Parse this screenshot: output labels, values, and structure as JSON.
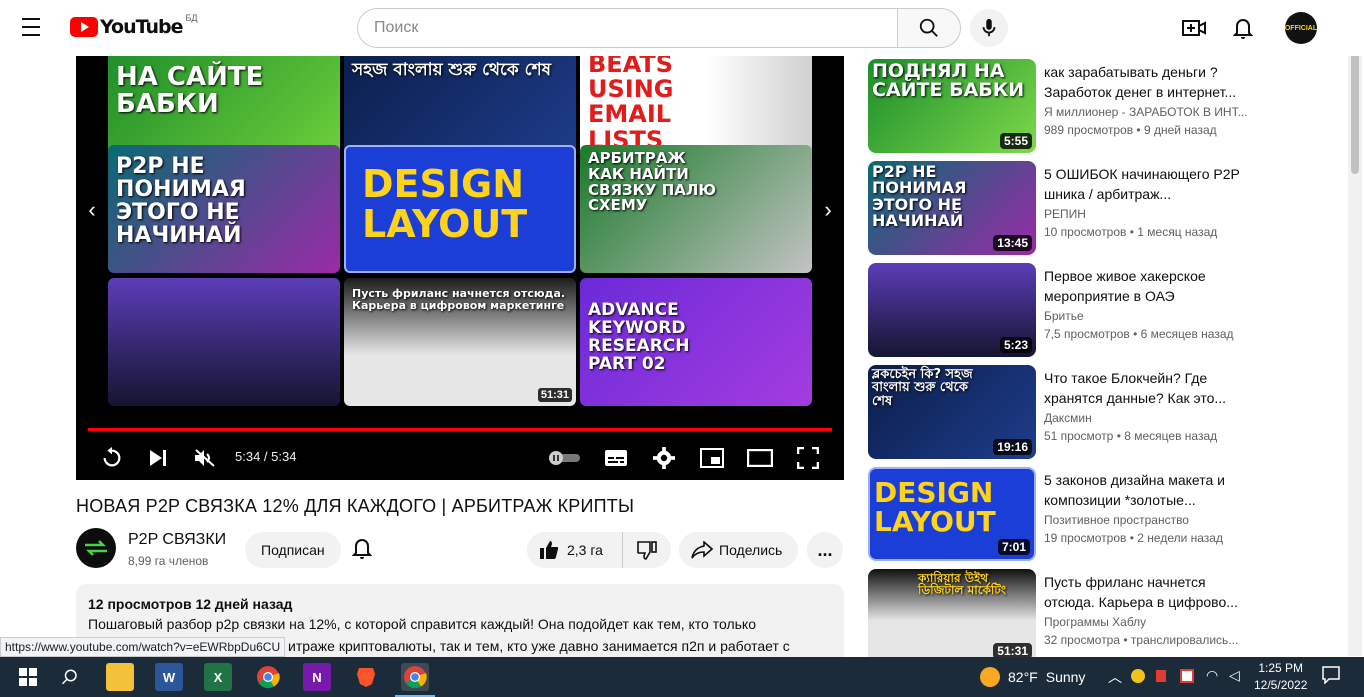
{
  "header": {
    "logo_text": "YouTube",
    "country_code": "БД",
    "search_placeholder": "Поиск",
    "avatar_text": "OFFICIAL"
  },
  "player": {
    "time_current": "5:34",
    "time_total": "5:34",
    "time_display": "5:34 / 5:34",
    "progress": 1.0,
    "endscreen": [
      {
        "text": "НА САЙТЕ БАБКИ",
        "duration": ""
      },
      {
        "text": "সহজ বাংলায় শুরু থেকে শেষ",
        "duration": ""
      },
      {
        "text": "BEATS USING EMAIL LISTS",
        "duration": ""
      },
      {
        "text": "P2P НЕ ПОНИМАЯ ЭТОГО НЕ НАЧИНАЙ",
        "duration": ""
      },
      {
        "text": "DESIGN LAYOUT",
        "duration": ""
      },
      {
        "text": "АРБИТРАЖ КАК НАЙТИ СВЯЗКУ ПАЛЮ СХЕМУ",
        "duration": ""
      },
      {
        "text": "",
        "duration": ""
      },
      {
        "text": "Пусть фриланс начнется отсюда. Карьера в цифровом маркетинге",
        "duration": "51:31"
      },
      {
        "text": "ADVANCE KEYWORD RESEARCH PART 02",
        "duration": ""
      }
    ]
  },
  "video": {
    "title": "НОВАЯ P2P СВЯЗКА 12% ДЛЯ КАЖДОГО | АРБИТРАЖ КРИПТЫ",
    "channel_name": "P2P СВЯЗКИ",
    "channel_subs": "8,99 га членов",
    "subscribe_label": "Подписан",
    "like_count": "2,3 га",
    "share_label": "Поделись",
    "more_label": "...",
    "desc_meta": "12 просмотров 12 дней назад",
    "desc_line1": "Пошаговый разбор p2p связки на 12%, с которой справится каждый! Она подойдет как тем, кто только",
    "desc_line2": "итраже криптовалюты, так и тем, кто уже давно занимается п2п и работает с"
  },
  "status_url": "https://www.youtube.com/watch?v=eEWRbpDu6CU",
  "recommendations": [
    {
      "title": "как зарабатывать деньги ? Заработок денег в интернет...",
      "channel": "Я миллионер - ЗАРАБОТОК В ИНТ...",
      "meta": "989 просмотров • 9 дней назад",
      "duration": "5:55",
      "thumb_text": "ПОДНЯЛ НА САЙТЕ БАБКИ"
    },
    {
      "title": "5 ОШИБОК начинающего P2P шника / арбитраж...",
      "channel": "РЕПИН",
      "meta": "10 просмотров • 1 месяц назад",
      "duration": "13:45",
      "thumb_text": "P2P НЕ ПОНИМАЯ ЭТОГО НЕ НАЧИНАЙ"
    },
    {
      "title": "Первое живое хакерское мероприятие в ОАЭ",
      "channel": "Бритье",
      "meta": "7,5 просмотров • 6 месяцев назад",
      "duration": "5:23",
      "thumb_text": ""
    },
    {
      "title": "Что такое Блокчейн? Где хранятся данные? Как это...",
      "channel": "Даксмин",
      "meta": "51 просмотр • 8 месяцев назад",
      "duration": "19:16",
      "thumb_text": "ব্লকচেইন কি? সহজ বাংলায় শুরু থেকে শেষ"
    },
    {
      "title": "5 законов дизайна макета и композиции *золотые...",
      "channel": "Позитивное пространство",
      "meta": "19 просмотров • 2 недели назад",
      "duration": "7:01",
      "thumb_text": "DESIGN LAYOUT"
    },
    {
      "title": "Пусть фриланс начнется отсюда. Карьера в цифрово...",
      "channel": "Программы Хаблу",
      "meta": "32 просмотра • транслировались...",
      "duration": "51:31",
      "thumb_text": "ক্যারিয়ার উইথ ডিজিটাল মার্কেটিং"
    }
  ],
  "taskbar": {
    "weather_temp": "82°F",
    "weather_text": "Sunny",
    "time": "1:25 PM",
    "date": "12/5/2022",
    "apps": [
      "start",
      "search",
      "file-explorer",
      "word",
      "excel",
      "chrome",
      "onenote",
      "brave",
      "chrome-active"
    ]
  }
}
